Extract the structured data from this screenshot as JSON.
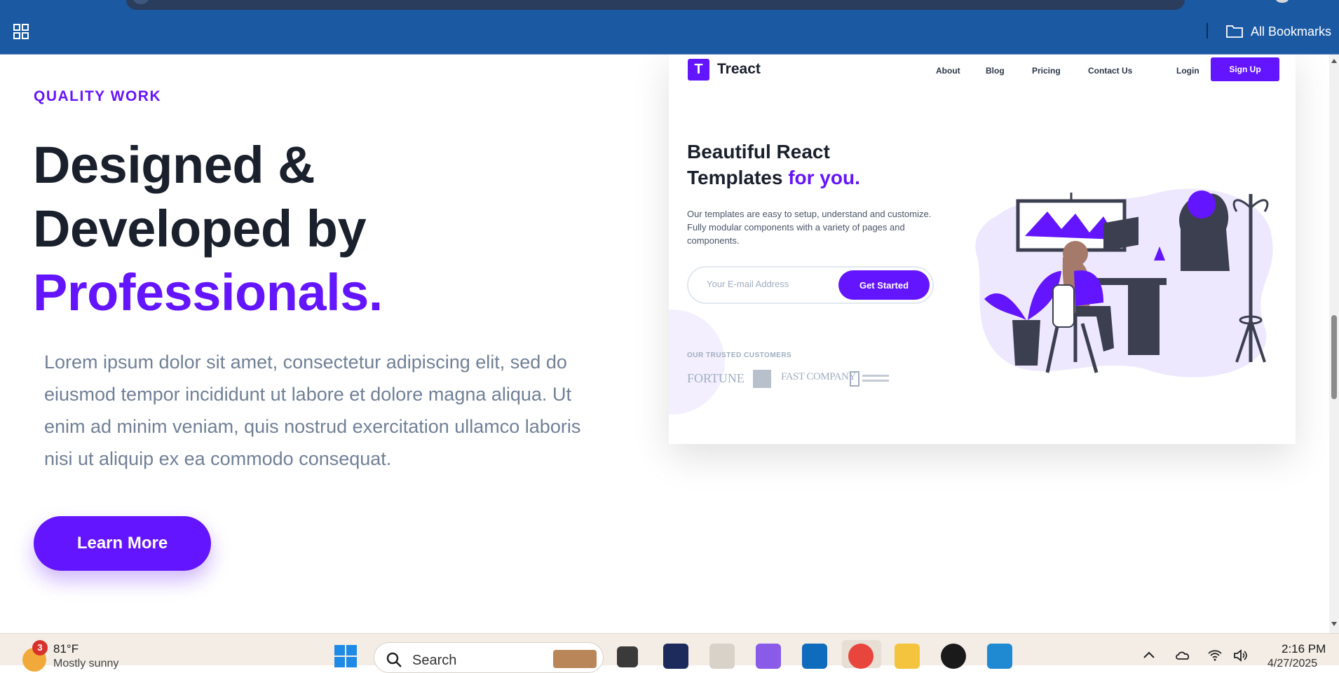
{
  "browser": {
    "bookmarks_label": "All Bookmarks"
  },
  "hero": {
    "eyebrow": "QUALITY WORK",
    "headline_line1": "Designed &",
    "headline_line2": "Developed by",
    "headline_accent": "Professionals.",
    "paragraph": "Lorem ipsum dolor sit amet, consectetur adipiscing elit, sed do eiusmod tempor incididunt ut labore et dolore magna aliqua. Ut enim ad minim veniam, quis nostrud exercitation ullamco laboris nisi ut aliquip ex ea commodo consequat.",
    "cta_label": "Learn More",
    "accent_color": "#6415ff"
  },
  "preview": {
    "logo_letter": "T",
    "brand": "Treact",
    "nav": [
      "About",
      "Blog",
      "Pricing",
      "Contact Us"
    ],
    "login": "Login",
    "signup": "Sign Up",
    "heading_line1": "Beautiful React",
    "heading_line2": "Templates",
    "heading_accent": "for you.",
    "description": "Our templates are easy to setup, understand and customize. Fully modular components with a variety of pages and components.",
    "email_placeholder": "Your E-mail Address",
    "get_started": "Get Started",
    "trusted_label": "OUR TRUSTED CUSTOMERS",
    "customers": [
      "FORTUNE",
      "FAST COMPANY"
    ]
  },
  "taskbar": {
    "weather_badge": "3",
    "weather_temp": "81°F",
    "weather_condition": "Mostly sunny",
    "search_label": "Search",
    "clock_time": "2:16 PM",
    "clock_date": "4/27/2025",
    "apps": [
      "file-explorer-icon",
      "powershell-icon",
      "dev-tools-icon",
      "visual-studio-icon",
      "outlook-icon",
      "chrome-icon",
      "folder-icon",
      "chatgpt-icon",
      "vscode-icon"
    ]
  }
}
